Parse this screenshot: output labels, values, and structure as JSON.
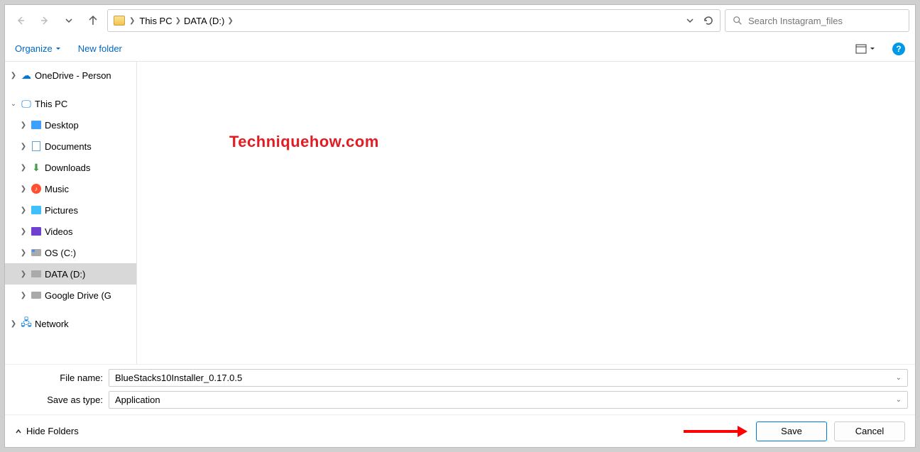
{
  "nav": {
    "breadcrumb": [
      "This PC",
      "DATA (D:)"
    ],
    "search_placeholder": "Search Instagram_files"
  },
  "toolbar": {
    "organize": "Organize",
    "new_folder": "New folder"
  },
  "tree": {
    "onedrive": "OneDrive - Person",
    "thispc": "This PC",
    "desktop": "Desktop",
    "documents": "Documents",
    "downloads": "Downloads",
    "music": "Music",
    "pictures": "Pictures",
    "videos": "Videos",
    "osc": "OS (C:)",
    "datad": "DATA (D:)",
    "gdrive": "Google Drive (G",
    "network": "Network"
  },
  "watermark": "Techniquehow.com",
  "form": {
    "filename_label": "File name:",
    "filename_value": "BlueStacks10Installer_0.17.0.5",
    "saveas_label": "Save as type:",
    "saveas_value": "Application"
  },
  "footer": {
    "hide_folders": "Hide Folders",
    "save": "Save",
    "cancel": "Cancel"
  }
}
